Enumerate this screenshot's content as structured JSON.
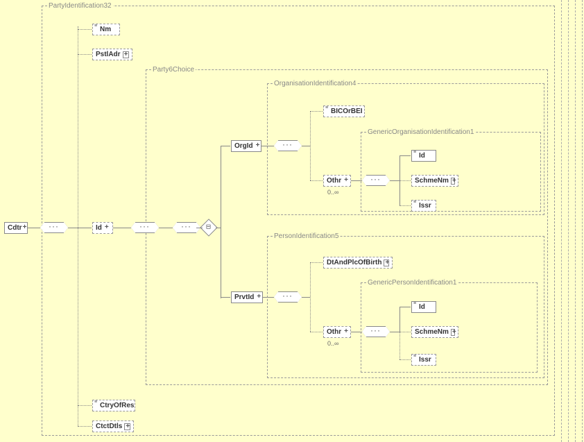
{
  "root": {
    "label": "Cdtr"
  },
  "group_party_id32": {
    "title": "PartyIdentification32"
  },
  "nm": {
    "label": "Nm"
  },
  "pstladr": {
    "label": "PstlAdr"
  },
  "id": {
    "label": "Id"
  },
  "ctryofres": {
    "label": "CtryOfRes"
  },
  "ctctdtls": {
    "label": "CtctDtls"
  },
  "group_party6": {
    "title": "Party6Choice"
  },
  "orgid": {
    "label": "OrgId"
  },
  "prvtid": {
    "label": "PrvtId"
  },
  "group_orgident4": {
    "title": "OrganisationIdentification4"
  },
  "bicorbei": {
    "label": "BICOrBEI"
  },
  "othr1": {
    "label": "Othr",
    "occ": "0..∞"
  },
  "group_genorgident1": {
    "title": "GenericOrganisationIdentification1"
  },
  "go_id": {
    "label": "Id"
  },
  "go_schmenm": {
    "label": "SchmeNm"
  },
  "go_issr": {
    "label": "Issr"
  },
  "group_persident5": {
    "title": "PersonIdentification5"
  },
  "dtplcbirth": {
    "label": "DtAndPlcOfBirth"
  },
  "othr2": {
    "label": "Othr",
    "occ": "0..∞"
  },
  "group_genpersident1": {
    "title": "GenericPersonIdentification1"
  },
  "gp_id": {
    "label": "Id"
  },
  "gp_schmenm": {
    "label": "SchmeNm"
  },
  "gp_issr": {
    "label": "Issr"
  }
}
